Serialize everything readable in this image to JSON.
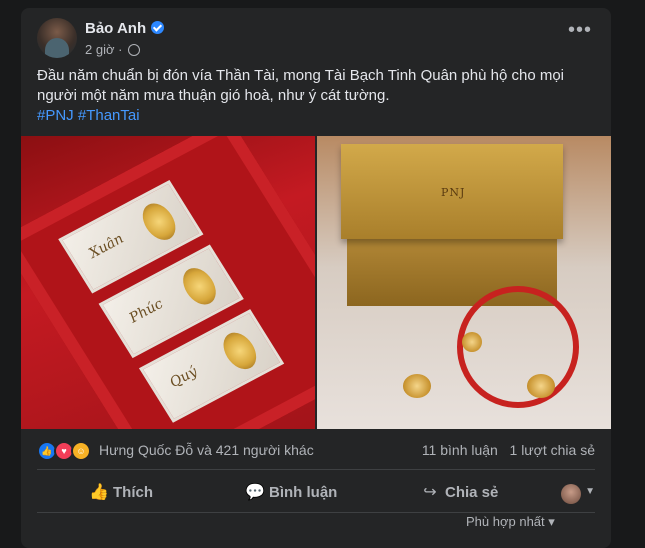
{
  "post": {
    "author": "Bảo Anh",
    "time": "2 giờ",
    "more": "•••",
    "text": "Đầu năm chuẩn bị đón vía Thần Tài, mong Tài Bạch Tinh Quân phù hộ cho mọi người một năm mưa thuận gió hoà, như ý cát tường.",
    "hashtags": "#PNJ #ThanTai"
  },
  "photos": {
    "left_labels": [
      "Xuân",
      "Phúc",
      "Quý"
    ],
    "right_brand": "PNJ"
  },
  "reactions": {
    "summary": "Hưng Quốc Đỗ và 421 người khác",
    "comments": "11 bình luận",
    "shares": "1 lượt chia sẻ",
    "icons": [
      "like-icon",
      "love-icon",
      "care-icon"
    ]
  },
  "actions": {
    "like": "Thích",
    "comment": "Bình luận",
    "share": "Chia sẻ"
  },
  "footer": {
    "sort": "Phù hợp nhất ▾"
  }
}
